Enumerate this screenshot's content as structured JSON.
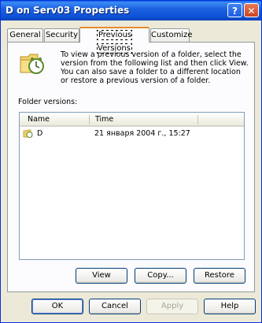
{
  "window": {
    "title": "D on Serv03 Properties"
  },
  "titlebar_buttons": {
    "help": "?",
    "close": "✕"
  },
  "tabs": [
    {
      "label": "General"
    },
    {
      "label": "Security"
    },
    {
      "label": "Previous Versions"
    },
    {
      "label": "Customize"
    }
  ],
  "panel": {
    "intro": "To view a previous version of a folder, select the version from the following list and then click View. You can also save a folder to a different location or restore a previous version of a folder.",
    "list_label": "Folder versions:",
    "columns": {
      "name": "Name",
      "time": "Time"
    },
    "rows": [
      {
        "name": "D",
        "time": "21 января 2004 г., 15:27"
      }
    ],
    "buttons": {
      "view": "View",
      "copy": "Copy...",
      "restore": "Restore"
    }
  },
  "footer": {
    "ok": "OK",
    "cancel": "Cancel",
    "apply": "Apply",
    "help": "Help"
  },
  "colors": {
    "title_bar": "#0a5fe6",
    "active_tab_accent": "#e68b2c",
    "dialog_bg": "#ece9d8"
  }
}
